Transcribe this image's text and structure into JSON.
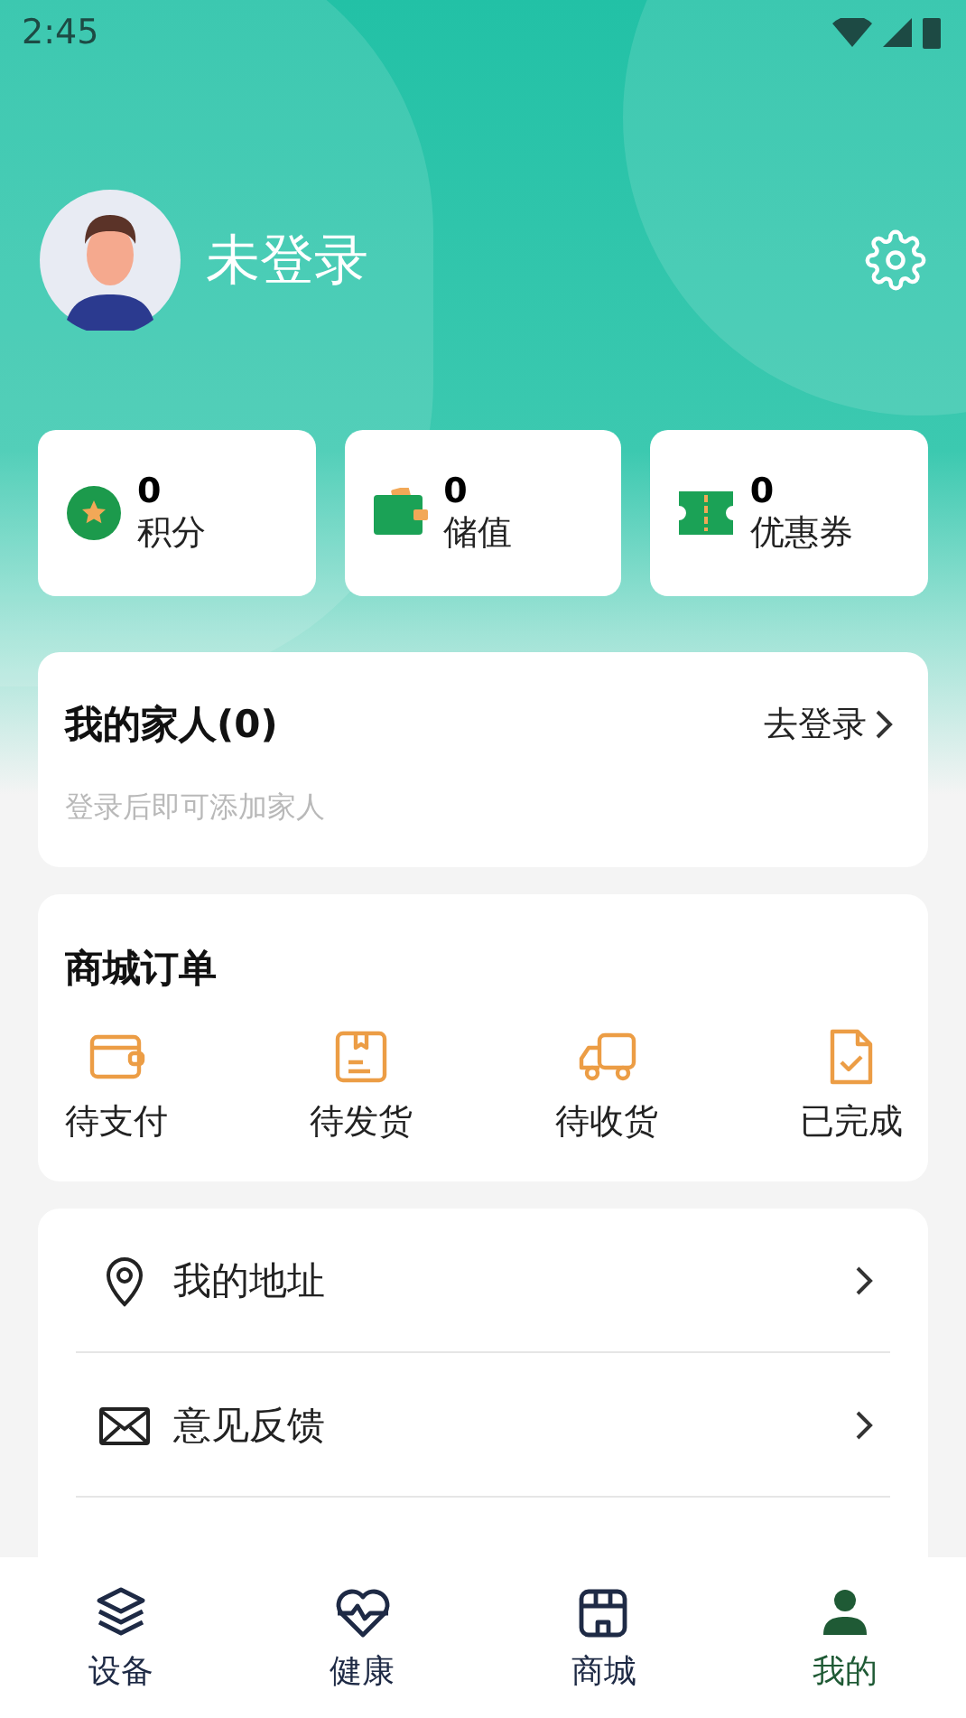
{
  "status_bar": {
    "time": "2:45"
  },
  "profile": {
    "name": "未登录"
  },
  "stats": [
    {
      "kind": "points",
      "value": "0",
      "label": "积分"
    },
    {
      "kind": "wallet",
      "value": "0",
      "label": "储值"
    },
    {
      "kind": "coupon",
      "value": "0",
      "label": "优惠券"
    }
  ],
  "family": {
    "title": "我的家人(0)",
    "action": "去登录",
    "hint": "登录后即可添加家人"
  },
  "orders": {
    "title": "商城订单",
    "items": [
      {
        "kind": "pay",
        "label": "待支付"
      },
      {
        "kind": "ship",
        "label": "待发货"
      },
      {
        "kind": "receive",
        "label": "待收货"
      },
      {
        "kind": "done",
        "label": "已完成"
      }
    ]
  },
  "menu": [
    {
      "kind": "address",
      "label": "我的地址"
    },
    {
      "kind": "feedback",
      "label": "意见反馈"
    }
  ],
  "tab_bar": [
    {
      "kind": "device",
      "label": "设备",
      "selected": false
    },
    {
      "kind": "health",
      "label": "健康",
      "selected": false
    },
    {
      "kind": "mall",
      "label": "商城",
      "selected": false
    },
    {
      "kind": "me",
      "label": "我的",
      "selected": true
    }
  ]
}
